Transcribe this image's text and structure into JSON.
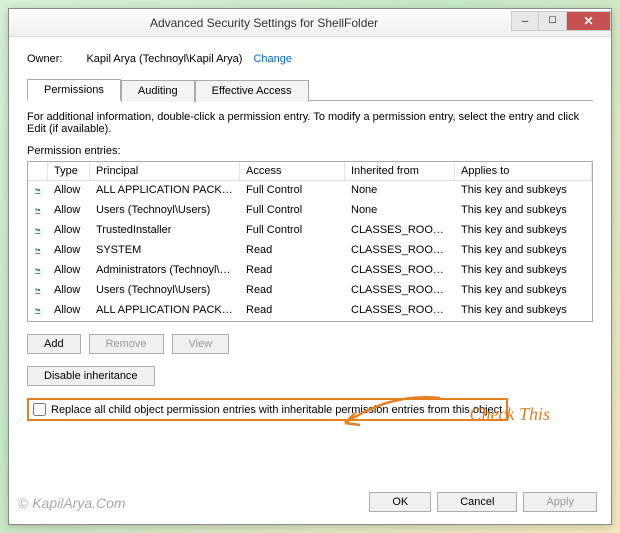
{
  "titlebar": {
    "title": "Advanced Security Settings for ShellFolder"
  },
  "owner": {
    "label": "Owner:",
    "value": "Kapil Arya (Technoyl\\Kapil Arya)",
    "change": "Change"
  },
  "tabs": {
    "permissions": "Permissions",
    "auditing": "Auditing",
    "effective": "Effective Access"
  },
  "info": "For additional information, double-click a permission entry. To modify a permission entry, select the entry and click Edit (if available).",
  "entries_label": "Permission entries:",
  "columns": {
    "type": "Type",
    "principal": "Principal",
    "access": "Access",
    "inherited": "Inherited from",
    "applies": "Applies to"
  },
  "rows": [
    {
      "type": "Allow",
      "principal": "ALL APPLICATION PACKAGES",
      "access": "Full Control",
      "inherited": "None",
      "applies": "This key and subkeys"
    },
    {
      "type": "Allow",
      "principal": "Users (Technoyl\\Users)",
      "access": "Full Control",
      "inherited": "None",
      "applies": "This key and subkeys"
    },
    {
      "type": "Allow",
      "principal": "TrustedInstaller",
      "access": "Full Control",
      "inherited": "CLASSES_ROOT\\CLSID...",
      "applies": "This key and subkeys"
    },
    {
      "type": "Allow",
      "principal": "SYSTEM",
      "access": "Read",
      "inherited": "CLASSES_ROOT\\CLSID...",
      "applies": "This key and subkeys"
    },
    {
      "type": "Allow",
      "principal": "Administrators (Technoyl\\Ad...",
      "access": "Read",
      "inherited": "CLASSES_ROOT\\CLSID...",
      "applies": "This key and subkeys"
    },
    {
      "type": "Allow",
      "principal": "Users (Technoyl\\Users)",
      "access": "Read",
      "inherited": "CLASSES_ROOT\\CLSID...",
      "applies": "This key and subkeys"
    },
    {
      "type": "Allow",
      "principal": "ALL APPLICATION PACKAGES",
      "access": "Read",
      "inherited": "CLASSES_ROOT\\CLSID...",
      "applies": "This key and subkeys"
    }
  ],
  "buttons": {
    "add": "Add",
    "remove": "Remove",
    "view": "View",
    "disable": "Disable inheritance"
  },
  "replace_label": "Replace all child object permission entries with inheritable permission entries from this object",
  "footer": {
    "ok": "OK",
    "cancel": "Cancel",
    "apply": "Apply"
  },
  "annotation": "Check This",
  "watermark": "© KapilArya.Com"
}
